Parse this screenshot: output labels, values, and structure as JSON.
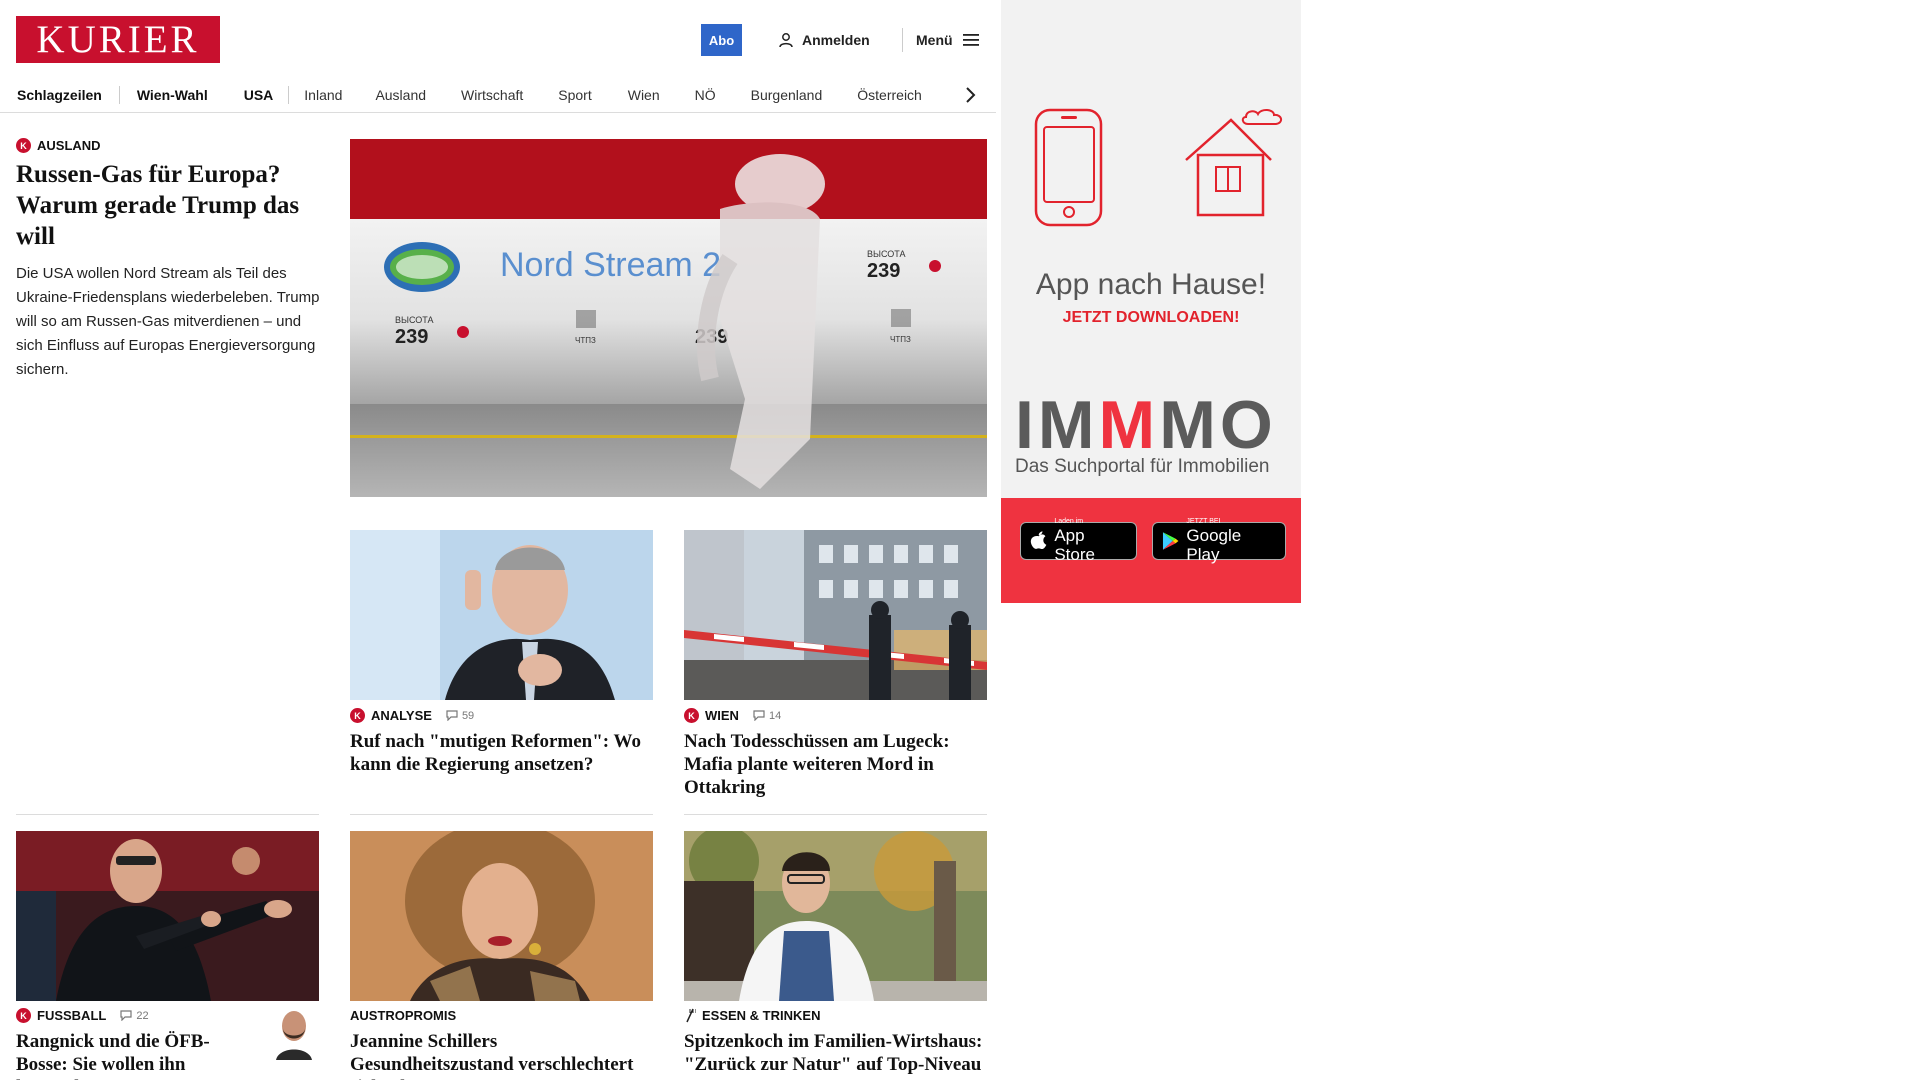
{
  "header": {
    "logo_text": "KURIER",
    "abo_label": "Abo",
    "login_label": "Anmelden",
    "menu_label": "Menü"
  },
  "nav": {
    "items": [
      "Schlagzeilen",
      "Wien-Wahl",
      "USA",
      "Inland",
      "Ausland",
      "Wirtschaft",
      "Sport",
      "Wien",
      "NÖ",
      "Burgenland",
      "Österreich"
    ]
  },
  "lead": {
    "kicker": "AUSLAND",
    "badge": "K",
    "title": "Russen-Gas für Europa? Warum gerade Trump das will",
    "text": "Die USA wollen Nord Stream als Teil des Ukraine-Friedensplans wiederbeleben. Trump will so am Russen-Gas mitverdienen – und sich Einfluss auf Europas Energieversorgung sichern.",
    "image": {
      "pipe_label": "Nord Stream 2",
      "marking": "ВЫСОТА",
      "marking_value": "239",
      "plant_code": "ЧТПЗ"
    }
  },
  "cards_row1": [
    {
      "kicker": "ANALYSE",
      "badge": "K",
      "comments": "59",
      "title": "Ruf nach \"mutigen Reformen\": Wo kann die Regierung ansetzen?"
    },
    {
      "kicker": "WIEN",
      "badge": "K",
      "comments": "14",
      "title": "Nach Todesschüssen am Lugeck: Mafia plante weiteren Mord in Ottakring"
    }
  ],
  "cards_row2": [
    {
      "kicker": "FUSSBALL",
      "badge": "K",
      "comments": "22",
      "title": "Rangnick und die ÖFB-Bosse: Sie wollen ihn loswerden"
    },
    {
      "kicker": "AUSTROPROMIS",
      "title": "Jeannine Schillers Gesundheitszustand verschlechtert sich: Ihre"
    },
    {
      "kicker": "ESSEN & TRINKEN",
      "title": "Spitzenkoch im Familien-Wirtshaus: \"Zurück zur Natur\" auf Top-Niveau"
    }
  ],
  "ad": {
    "title": "App nach Hause!",
    "subtitle": "JETZT DOWNLOADEN!",
    "brand_a": "IM",
    "brand_m": "M",
    "brand_b": "MO",
    "tagline": "Das Suchportal für Immobilien",
    "appstore_small": "Laden im",
    "appstore_big": "App Store",
    "googleplay_small": "JETZT BEI",
    "googleplay_big": "Google Play"
  },
  "colors": {
    "brand_red": "#c8102e",
    "abo_blue": "#2f66c9",
    "ad_red": "#ef3340"
  },
  "icons": [
    "user-icon",
    "hamburger-icon",
    "chevron-right-icon",
    "comment-icon",
    "kurier-k-badge-icon",
    "fork-icon",
    "apple-icon",
    "google-play-icon"
  ]
}
